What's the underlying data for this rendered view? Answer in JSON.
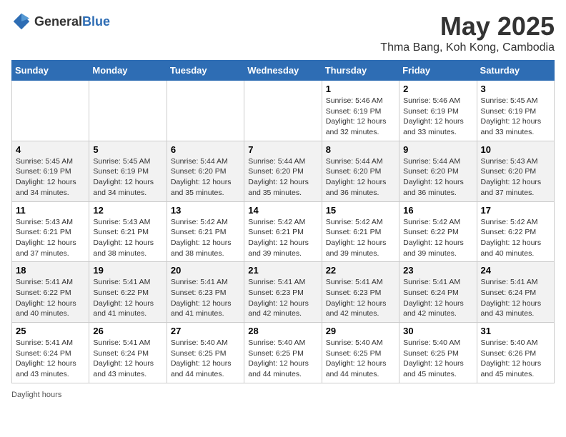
{
  "header": {
    "logo_general": "General",
    "logo_blue": "Blue",
    "title": "May 2025",
    "subtitle": "Thma Bang, Koh Kong, Cambodia"
  },
  "weekdays": [
    "Sunday",
    "Monday",
    "Tuesday",
    "Wednesday",
    "Thursday",
    "Friday",
    "Saturday"
  ],
  "weeks": [
    [
      {
        "day": "",
        "info": ""
      },
      {
        "day": "",
        "info": ""
      },
      {
        "day": "",
        "info": ""
      },
      {
        "day": "",
        "info": ""
      },
      {
        "day": "1",
        "info": "Sunrise: 5:46 AM\nSunset: 6:19 PM\nDaylight: 12 hours and 32 minutes."
      },
      {
        "day": "2",
        "info": "Sunrise: 5:46 AM\nSunset: 6:19 PM\nDaylight: 12 hours and 33 minutes."
      },
      {
        "day": "3",
        "info": "Sunrise: 5:45 AM\nSunset: 6:19 PM\nDaylight: 12 hours and 33 minutes."
      }
    ],
    [
      {
        "day": "4",
        "info": "Sunrise: 5:45 AM\nSunset: 6:19 PM\nDaylight: 12 hours and 34 minutes."
      },
      {
        "day": "5",
        "info": "Sunrise: 5:45 AM\nSunset: 6:19 PM\nDaylight: 12 hours and 34 minutes."
      },
      {
        "day": "6",
        "info": "Sunrise: 5:44 AM\nSunset: 6:20 PM\nDaylight: 12 hours and 35 minutes."
      },
      {
        "day": "7",
        "info": "Sunrise: 5:44 AM\nSunset: 6:20 PM\nDaylight: 12 hours and 35 minutes."
      },
      {
        "day": "8",
        "info": "Sunrise: 5:44 AM\nSunset: 6:20 PM\nDaylight: 12 hours and 36 minutes."
      },
      {
        "day": "9",
        "info": "Sunrise: 5:44 AM\nSunset: 6:20 PM\nDaylight: 12 hours and 36 minutes."
      },
      {
        "day": "10",
        "info": "Sunrise: 5:43 AM\nSunset: 6:20 PM\nDaylight: 12 hours and 37 minutes."
      }
    ],
    [
      {
        "day": "11",
        "info": "Sunrise: 5:43 AM\nSunset: 6:21 PM\nDaylight: 12 hours and 37 minutes."
      },
      {
        "day": "12",
        "info": "Sunrise: 5:43 AM\nSunset: 6:21 PM\nDaylight: 12 hours and 38 minutes."
      },
      {
        "day": "13",
        "info": "Sunrise: 5:42 AM\nSunset: 6:21 PM\nDaylight: 12 hours and 38 minutes."
      },
      {
        "day": "14",
        "info": "Sunrise: 5:42 AM\nSunset: 6:21 PM\nDaylight: 12 hours and 39 minutes."
      },
      {
        "day": "15",
        "info": "Sunrise: 5:42 AM\nSunset: 6:21 PM\nDaylight: 12 hours and 39 minutes."
      },
      {
        "day": "16",
        "info": "Sunrise: 5:42 AM\nSunset: 6:22 PM\nDaylight: 12 hours and 39 minutes."
      },
      {
        "day": "17",
        "info": "Sunrise: 5:42 AM\nSunset: 6:22 PM\nDaylight: 12 hours and 40 minutes."
      }
    ],
    [
      {
        "day": "18",
        "info": "Sunrise: 5:41 AM\nSunset: 6:22 PM\nDaylight: 12 hours and 40 minutes."
      },
      {
        "day": "19",
        "info": "Sunrise: 5:41 AM\nSunset: 6:22 PM\nDaylight: 12 hours and 41 minutes."
      },
      {
        "day": "20",
        "info": "Sunrise: 5:41 AM\nSunset: 6:23 PM\nDaylight: 12 hours and 41 minutes."
      },
      {
        "day": "21",
        "info": "Sunrise: 5:41 AM\nSunset: 6:23 PM\nDaylight: 12 hours and 42 minutes."
      },
      {
        "day": "22",
        "info": "Sunrise: 5:41 AM\nSunset: 6:23 PM\nDaylight: 12 hours and 42 minutes."
      },
      {
        "day": "23",
        "info": "Sunrise: 5:41 AM\nSunset: 6:24 PM\nDaylight: 12 hours and 42 minutes."
      },
      {
        "day": "24",
        "info": "Sunrise: 5:41 AM\nSunset: 6:24 PM\nDaylight: 12 hours and 43 minutes."
      }
    ],
    [
      {
        "day": "25",
        "info": "Sunrise: 5:41 AM\nSunset: 6:24 PM\nDaylight: 12 hours and 43 minutes."
      },
      {
        "day": "26",
        "info": "Sunrise: 5:41 AM\nSunset: 6:24 PM\nDaylight: 12 hours and 43 minutes."
      },
      {
        "day": "27",
        "info": "Sunrise: 5:40 AM\nSunset: 6:25 PM\nDaylight: 12 hours and 44 minutes."
      },
      {
        "day": "28",
        "info": "Sunrise: 5:40 AM\nSunset: 6:25 PM\nDaylight: 12 hours and 44 minutes."
      },
      {
        "day": "29",
        "info": "Sunrise: 5:40 AM\nSunset: 6:25 PM\nDaylight: 12 hours and 44 minutes."
      },
      {
        "day": "30",
        "info": "Sunrise: 5:40 AM\nSunset: 6:25 PM\nDaylight: 12 hours and 45 minutes."
      },
      {
        "day": "31",
        "info": "Sunrise: 5:40 AM\nSunset: 6:26 PM\nDaylight: 12 hours and 45 minutes."
      }
    ]
  ],
  "footer": {
    "daylight_label": "Daylight hours"
  }
}
